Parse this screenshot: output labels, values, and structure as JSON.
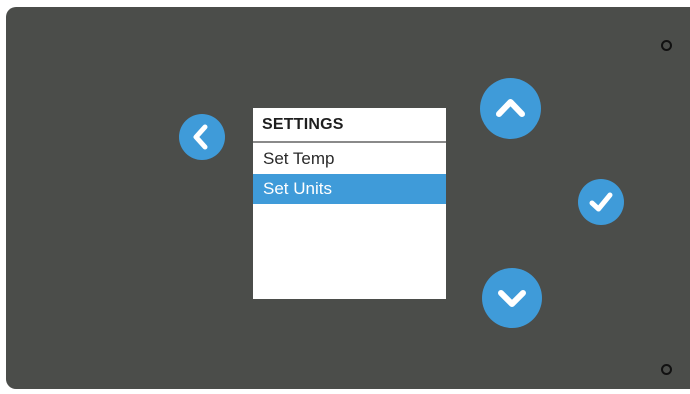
{
  "screen": {
    "title": "SETTINGS",
    "menu_items": [
      {
        "label": "Set Temp",
        "selected": false
      },
      {
        "label": "Set Units",
        "selected": true
      }
    ]
  },
  "buttons": {
    "back": {
      "icon": "chevron-left-icon"
    },
    "up": {
      "icon": "chevron-up-icon"
    },
    "down": {
      "icon": "chevron-down-icon"
    },
    "confirm": {
      "icon": "checkmark-icon"
    }
  },
  "colors": {
    "panel": "#4b4d4a",
    "accent": "#3f9bd9",
    "screen_bg": "#ffffff",
    "text": "#1f1f1f"
  }
}
